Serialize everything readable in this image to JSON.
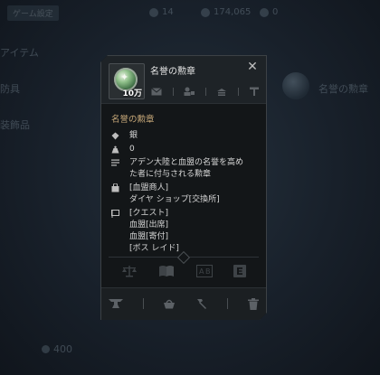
{
  "background": {
    "tab_label": "ゲーム設定",
    "stats": [
      "14",
      "174,065",
      "0"
    ],
    "left_labels": [
      "アイテム",
      "防具",
      "装飾品"
    ],
    "right_label": "名誉の勲章",
    "bottom_value": "400"
  },
  "popup": {
    "title": "名誉の勲章",
    "quantity": "10万",
    "item_name": "名誉の勲章",
    "grade": "銀",
    "weight": "0",
    "description_lines": [
      "アデン大陸と血盟の名誉を高め",
      "た者に付与される勲章"
    ],
    "shop_lines": [
      "[血盟商人]",
      "ダイヤ ショップ[交換所]"
    ],
    "source_lines": [
      "[クエスト]",
      "血盟[出席]",
      "血盟[寄付]",
      "[ボス レイド]"
    ]
  },
  "colors": {
    "item_name": "#c9aa7a",
    "panel_bg": "#131618",
    "header_bg": "#1e2327"
  }
}
